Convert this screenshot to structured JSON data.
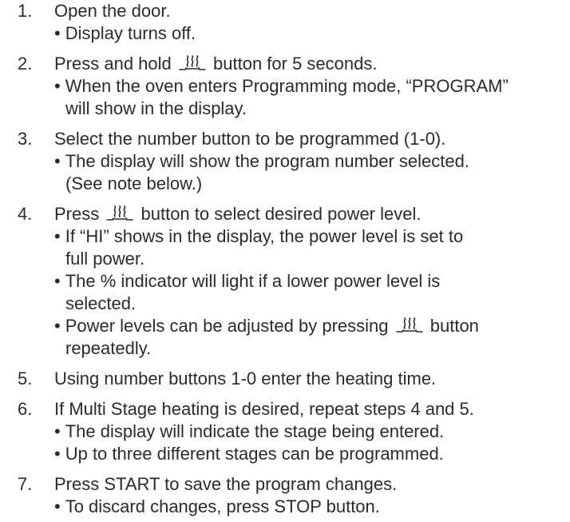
{
  "document": {
    "steps": [
      {
        "number": "1.",
        "text": "Open the door.",
        "bullets": [
          [
            "Display turns off."
          ]
        ]
      },
      {
        "number": "2.",
        "text_before": "Press and hold",
        "icon": "power-level-icon",
        "text_after": "button for 5 seconds.",
        "bullets": [
          [
            "When the oven enters Programming mode, “PROGRAM”",
            "will show in the display."
          ]
        ]
      },
      {
        "number": "3.",
        "text": "Select the number button to be programmed (1-0).",
        "bullets": [
          [
            "The display will show the program number selected.",
            "(See note below.)"
          ]
        ]
      },
      {
        "number": "4.",
        "text_before": "Press",
        "icon": "power-level-icon",
        "text_after": "button to select desired power level.",
        "bullets": [
          [
            "If “HI” shows in the display, the power level is set to",
            "full power."
          ],
          [
            "The % indicator will light if a lower power level is",
            "selected."
          ],
          {
            "text_before": "Power levels can be adjusted by pressing",
            "icon": "power-level-icon",
            "text_after": "button",
            "continuation": "repeatedly."
          }
        ]
      },
      {
        "number": "5.",
        "text": "Using number buttons 1-0 enter the heating time.",
        "bullets": []
      },
      {
        "number": "6.",
        "text": "If Multi Stage heating is desired, repeat steps 4 and 5.",
        "bullets": [
          [
            "The display will indicate the stage being entered."
          ],
          [
            "Up to three different stages can be programmed."
          ]
        ]
      },
      {
        "number": "7.",
        "text": "Press START to save the program changes.",
        "bullets": [
          [
            "To discard changes, press STOP button."
          ]
        ]
      }
    ]
  }
}
